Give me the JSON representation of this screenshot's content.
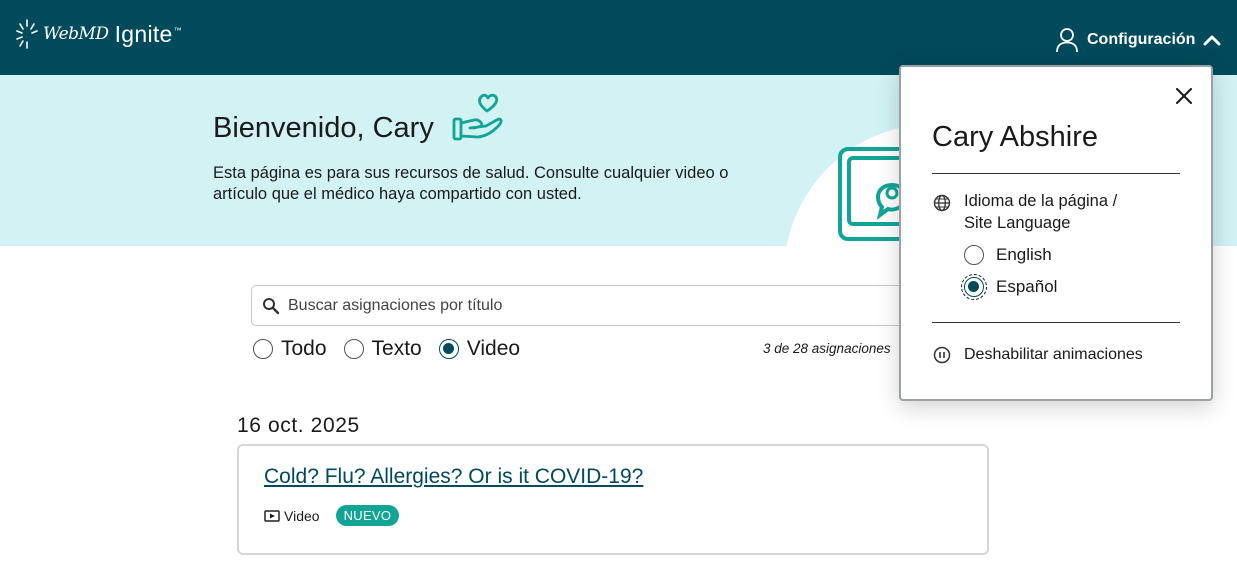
{
  "header": {
    "logo_webmd": "WebMD",
    "logo_ignite": "Ignite",
    "logo_tm": "™",
    "settings_label": "Configuración"
  },
  "hero": {
    "welcome": "Bienvenido, Cary",
    "description": "Esta página es para sus recursos de salud. Consulte cualquier video o artículo que el médico haya compartido con usted."
  },
  "search": {
    "placeholder": "Buscar asignaciones por título",
    "value": ""
  },
  "filters": {
    "options": [
      {
        "label": "Todo",
        "checked": false
      },
      {
        "label": "Texto",
        "checked": false
      },
      {
        "label": "Video",
        "checked": true
      }
    ],
    "count_text": "3 de 28 asignaciones"
  },
  "assignments": {
    "date": "16 oct. 2025",
    "items": [
      {
        "title": "Cold? Flu? Allergies? Or is it COVID-19?",
        "type": "Video",
        "badge": "NUEVO"
      }
    ]
  },
  "settings_panel": {
    "user_name": "Cary Abshire",
    "language_label_line1": "Idioma de la página /",
    "language_label_line2": "Site Language",
    "languages": [
      {
        "label": "English",
        "checked": false
      },
      {
        "label": "Español",
        "checked": true
      }
    ],
    "disable_animations": "Deshabilitar animaciones"
  },
  "colors": {
    "header_bg": "#014a5c",
    "hero_bg": "#d2f2f3",
    "accent_teal": "#12a596",
    "link": "#014a5c"
  },
  "icons": [
    "webmd-logo-icon",
    "user-icon",
    "chevron-up-icon",
    "heart-hands-icon",
    "laptop-chat-icon",
    "search-icon",
    "video-icon",
    "close-icon",
    "globe-icon",
    "pause-icon"
  ]
}
